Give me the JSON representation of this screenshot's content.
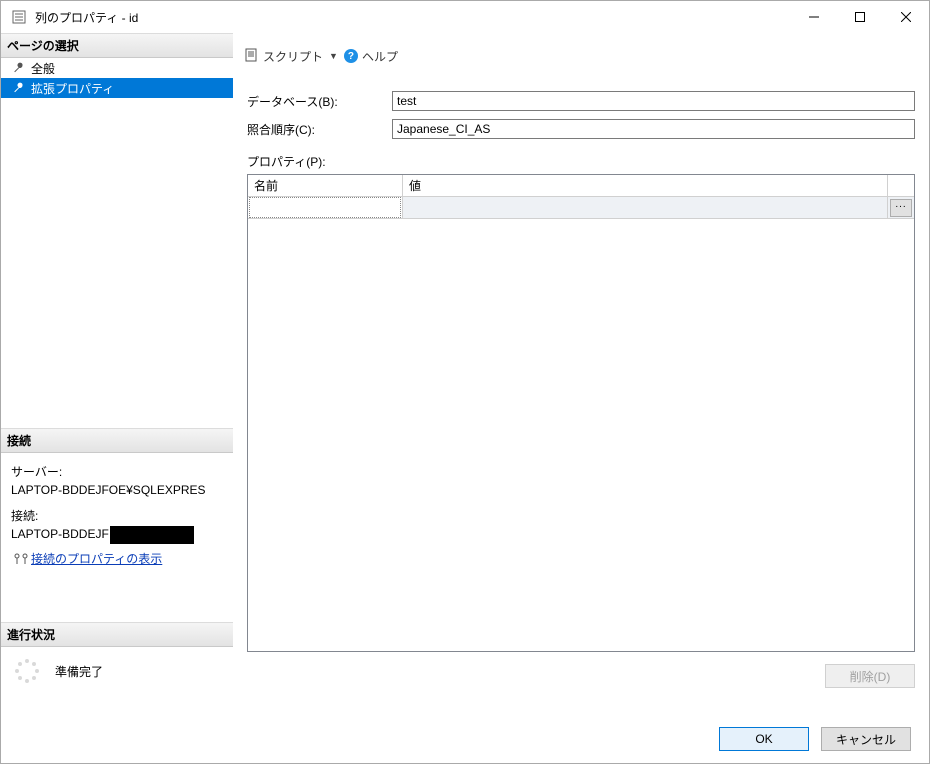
{
  "window": {
    "title": "列のプロパティ - id"
  },
  "sidebar": {
    "page_select_header": "ページの選択",
    "pages": [
      {
        "label": "全般",
        "selected": false
      },
      {
        "label": "拡張プロパティ",
        "selected": true
      }
    ],
    "connection_header": "接続",
    "connection": {
      "server_label": "サーバー:",
      "server_value": "LAPTOP-BDDEJFOE¥SQLEXPRES",
      "connection_label": "接続:",
      "connection_value_prefix": "LAPTOP-BDDEJF",
      "view_props_link": "接続のプロパティの表示"
    },
    "progress_header": "進行状況",
    "progress_status": "準備完了"
  },
  "toolbar": {
    "script_label": "スクリプト",
    "help_label": "ヘルプ"
  },
  "form": {
    "database_label": "データベース(B):",
    "database_value": "test",
    "collation_label": "照合順序(C):",
    "collation_value": "Japanese_CI_AS",
    "properties_label": "プロパティ(P):"
  },
  "grid": {
    "col_name": "名前",
    "col_value": "値",
    "ellipsis": "..."
  },
  "buttons": {
    "delete": "削除(D)",
    "ok": "OK",
    "cancel": "キャンセル"
  }
}
